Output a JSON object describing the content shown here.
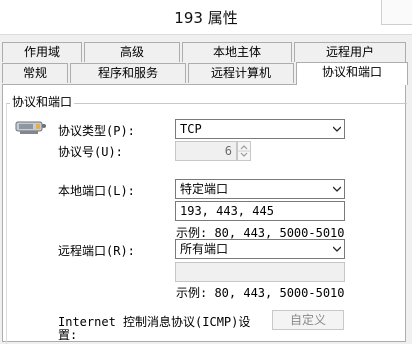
{
  "window": {
    "title": "193 属性"
  },
  "tabs": {
    "row1": [
      "作用域",
      "高级",
      "本地主体",
      "远程用户"
    ],
    "row2": [
      "常规",
      "程序和服务",
      "远程计算机",
      "协议和端口"
    ]
  },
  "group": {
    "title": "协议和端口"
  },
  "protocol_type": {
    "label": "协议类型(P):",
    "value": "TCP"
  },
  "protocol_number": {
    "label": "协议号(U):",
    "value": "6"
  },
  "local_port": {
    "label": "本地端口(L):",
    "value": "特定端口",
    "input_value": "193, 443, 445",
    "example": "示例: 80, 443, 5000-5010"
  },
  "remote_port": {
    "label": "远程端口(R):",
    "value": "所有端口",
    "input_value": "",
    "example": "示例: 80, 443, 5000-5010"
  },
  "icmp": {
    "label_line1": "Internet 控制消息协议(ICMP)设",
    "label_line2": "置:",
    "button": "自定义"
  },
  "colors": {
    "accent": "#0078d7",
    "disabled_text": "#8a8a8a"
  }
}
